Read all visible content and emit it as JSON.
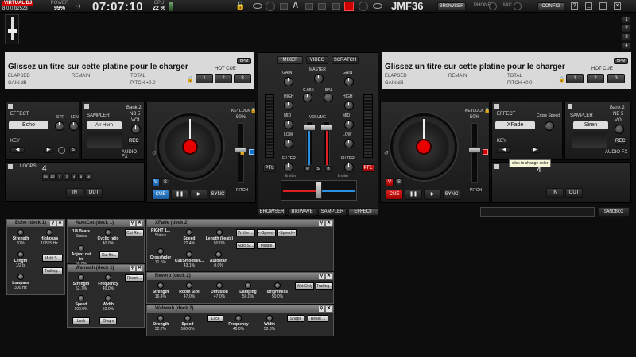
{
  "topbar": {
    "brand_line1": "VIRTUAL DJ",
    "brand_line2": "8.0.0 b2523",
    "power_label": "POWER",
    "power_value": "99%",
    "clock": "07:07:10",
    "cpu_label": "CPU",
    "cpu_value": "22 %",
    "mode_letter": "A",
    "profile": "JMF36",
    "browser_btn": "BROWSER",
    "phone_label": "PHONE",
    "mic_label": "MIC",
    "config_btn": "CONFIG",
    "layout_numbers": [
      "1",
      "2",
      "3",
      "4"
    ]
  },
  "deck1": {
    "title": "Glissez un titre sur cette platine pour le charger",
    "elapsed": "ELAPSED",
    "remain": "REMAIN",
    "total": "TOTAL",
    "gain": "GAIN dB",
    "pitch": "PITCH +0.0",
    "bpm": "BPM",
    "hotcue_label": "HOT CUE",
    "hotcues": [
      "1",
      "2",
      "3"
    ],
    "effect_label": "EFFECT",
    "effect_value": "Echo",
    "str": "STR",
    "len": "LEN",
    "key_label": "KEY",
    "sampler_label": "SAMPLER",
    "sampler_value": "Air Horn",
    "bank": "Bank 2",
    "nb": "NB 5",
    "vol": "VOL",
    "rec": "REC",
    "audio_fx": "AUDIO FX",
    "loops_label": "LOOPS",
    "loops_value": "4",
    "loop_sizes": [
      "1/4",
      "1/2",
      "1",
      "2",
      "4",
      "8",
      "16"
    ],
    "in_btn": "IN",
    "out_btn": "OUT",
    "keylock": "KEYLOCK",
    "keylock_pct": "50%",
    "pitch_label": "PITCH",
    "cue": "CUE",
    "play": "▶",
    "sync": "SYNC",
    "v": "V",
    "s": "S"
  },
  "deck2": {
    "title": "Glissez un titre sur cette platine pour le charger",
    "elapsed": "ELAPSED",
    "remain": "REMAIN",
    "total": "TOTAL",
    "gain": "GAIN dB",
    "pitch": "PITCH +0.0",
    "bpm": "BPM",
    "hotcue_label": "HOT CUE",
    "hotcues": [
      "1",
      "2",
      "3"
    ],
    "effect_label": "EFFECT",
    "effect_value": "XFade",
    "cross_speed": "Cross Speed",
    "key_label": "KEY",
    "sampler_label": "SAMPLER",
    "sampler_value": "Siren",
    "bank": "Bank 2",
    "nb": "NB 5",
    "vol": "VOL",
    "rec": "REC",
    "audio_fx": "AUDIO FX",
    "loops_value": "4",
    "tooltip": "click to change color",
    "in_btn": "IN",
    "out_btn": "OUT",
    "keylock": "KEYLOCK",
    "keylock_pct": "50%",
    "pitch_label": "PITCH",
    "cue": "CUE",
    "play": "▶",
    "sync": "SYNC",
    "v": "V",
    "s": "S"
  },
  "mixer": {
    "tabs": [
      "MIXER",
      "VIDEO",
      "SCRATCH"
    ],
    "gain": "GAIN",
    "master": "MASTER",
    "cmix": "C.MIX",
    "bal": "BAL",
    "high": "HIGH",
    "mid": "MID",
    "low": "LOW",
    "volume": "VOLUME",
    "filter": "FILTER",
    "pfl": "PFL",
    "limiter": "limiter",
    "r": "R",
    "s": "S",
    "b": "B"
  },
  "bottom_tabs": [
    "BROWSER",
    "BIGWAVE",
    "SAMPLER",
    "EFFECT"
  ],
  "sandbox": "SANDBOX",
  "fx_windows": [
    {
      "title": "Echo (deck 1)",
      "params": [
        [
          "Strength",
          "31%"
        ],
        [
          "Highpass",
          "10815 Hz"
        ],
        [
          "Length",
          "1/2 bt"
        ],
        [
          "Lowpass",
          "300 Hz"
        ]
      ],
      "buttons": [
        "Multi S...",
        "Trailing..."
      ]
    },
    {
      "title": "AutoCut (deck 1)",
      "params": [
        [
          "1/4 Beats",
          "Status"
        ],
        [
          "Cyclic ratio",
          "40.0%"
        ],
        [
          "Adjust cut in",
          "50.0%"
        ]
      ],
      "buttons": [
        "Cut Re...",
        "Cut fin..."
      ]
    },
    {
      "title": "Wahwah (deck 1)",
      "params": [
        [
          "Strength",
          "52.7%"
        ],
        [
          "Frequency",
          "40.0%"
        ],
        [
          "Speed",
          "100.0%"
        ],
        [
          "Width",
          "50.0%"
        ]
      ],
      "buttons": [
        "Reset ...",
        "Lock",
        "Shape"
      ]
    },
    {
      "title": "XFade (deck 2)",
      "params": [
        [
          "RIGHT 1...",
          "Status"
        ],
        [
          "Speed",
          "22.4%"
        ],
        [
          "Length (beats)",
          "50.0%"
        ],
        [
          "Crossfader",
          "71.5%"
        ],
        [
          "Cut/Smooth/F...",
          "43.1%"
        ],
        [
          "Autostart",
          "0.0%"
        ]
      ],
      "buttons": [
        "To the ...",
        "<-Speed-",
        "-Speed->",
        "Auto-St...",
        "Middle"
      ]
    },
    {
      "title": "Reverb (deck 2)",
      "params": [
        [
          "Strength",
          "16.4%"
        ],
        [
          "Room Size",
          "47.0%"
        ],
        [
          "Diffusion",
          "47.0%"
        ],
        [
          "Damping",
          "50.0%"
        ],
        [
          "Brightness",
          "50.0%"
        ]
      ],
      "buttons": [
        "Wet Only",
        "Trailing..."
      ]
    },
    {
      "title": "Wahwah (deck 2)",
      "params": [
        [
          "Strength",
          "52.7%"
        ],
        [
          "Speed",
          "100.0%"
        ],
        [
          "Frequency",
          "40.0%"
        ],
        [
          "Width",
          "50.0%"
        ]
      ],
      "buttons": [
        "Lock",
        "Shape",
        "Reset ..."
      ]
    }
  ]
}
